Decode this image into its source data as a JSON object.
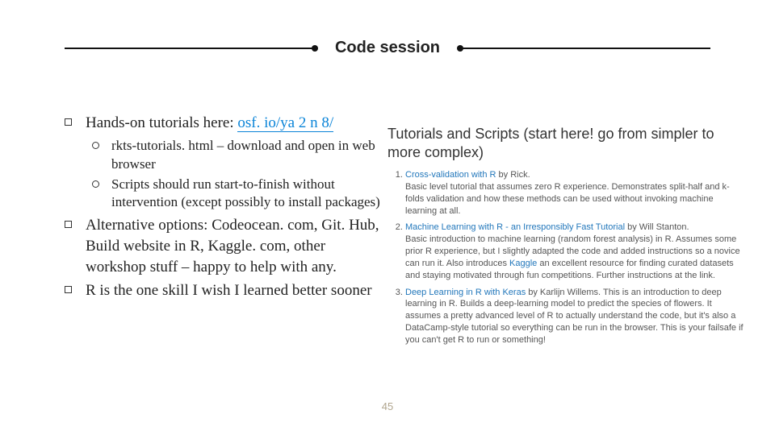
{
  "title": "Code session",
  "page_number": "45",
  "bullets": {
    "b1_pre": "Hands-on tutorials here: ",
    "b1_link": "osf. io/ya 2 n 8/",
    "b1_sub1": "rkts-tutorials. html – download and open in web browser",
    "b1_sub2": "Scripts should run start-to-finish without intervention (except possibly to install packages)",
    "b2": "Alternative options: Codeocean. com, Git. Hub, Build website in R, Kaggle. com, other workshop stuff – happy to help with any.",
    "b3": "R is the one skill I wish I learned better sooner"
  },
  "embed": {
    "heading": "Tutorials and Scripts (start here! go from simpler to more complex)",
    "item1_title": "Cross-validation with R",
    "item1_by": " by Rick.",
    "item1_body": "Basic level tutorial that assumes zero R experience. Demonstrates split-half and k-folds validation and how these methods can be used without invoking machine learning at all.",
    "item2_title": "Machine Learning with R - an Irresponsibly Fast Tutorial",
    "item2_by": " by Will Stanton.",
    "item2_body_pre": "Basic introduction to machine learning (random forest analysis) in R. Assumes some prior R experience, but I slightly adapted the code and added instructions so a novice can run it. Also introduces ",
    "item2_kaggle": "Kaggle",
    "item2_body_post": " an excellent resource for finding curated datasets and staying motivated through fun competitions. Further instructions at the link.",
    "item3_title": "Deep Learning in R with Keras",
    "item3_by": " by Karlijn Willems. ",
    "item3_body": "This is an introduction to deep learning in R. Builds a deep-learning model to predict the species of flowers. It assumes a pretty advanced level of R to actually understand the code, but it's also a DataCamp-style tutorial so everything can be run in the browser. This is your failsafe if you can't get R to run or something!"
  }
}
